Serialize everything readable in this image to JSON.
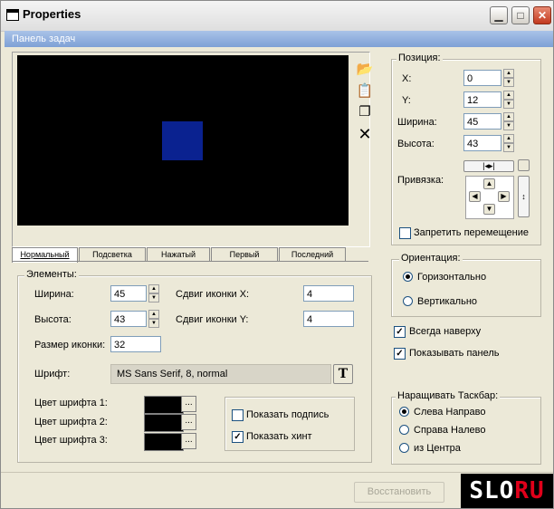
{
  "window": {
    "title": "Properties"
  },
  "panel_header": "Панель задач",
  "tabs": [
    "Нормальный",
    "Подсветка",
    "Нажатый",
    "Первый",
    "Последний"
  ],
  "elements": {
    "legend": "Элементы:",
    "width_label": "Ширина:",
    "width_value": "45",
    "height_label": "Высота:",
    "height_value": "43",
    "icon_size_label": "Размер иконки:",
    "icon_size_value": "32",
    "shift_x_label": "Сдвиг иконки X:",
    "shift_x_value": "4",
    "shift_y_label": "Сдвиг иконки Y:",
    "shift_y_value": "4",
    "font_label": "Шрифт:",
    "font_value": "MS Sans Serif, 8, normal",
    "font_button": "T",
    "color1_label": "Цвет шрифта 1:",
    "color2_label": "Цвет шрифта 2:",
    "color3_label": "Цвет шрифта 3:",
    "color_button": "...",
    "show_caption": "Показать подпись",
    "show_hint": "Показать хинт",
    "font_colors": [
      "#000000",
      "#000000",
      "#000000"
    ]
  },
  "position": {
    "legend": "Позиция:",
    "x_label": "X:",
    "x_value": "0",
    "y_label": "Y:",
    "y_value": "12",
    "width_label": "Ширина:",
    "width_value": "45",
    "height_label": "Высота:",
    "height_value": "43",
    "anchor_label": "Привязка:",
    "lock_move": "Запретить перемещение"
  },
  "orientation": {
    "legend": "Ориентация:",
    "horizontal": "Горизонтально",
    "vertical": "Вертикально"
  },
  "always_on_top": "Всегда наверху",
  "show_panel": "Показывать панель",
  "grow": {
    "legend": "Наращивать Таскбар:",
    "left_to_right": "Слева Направо",
    "right_to_left": "Справа Налево",
    "from_center": "из Центра"
  },
  "restore_button": "Восстановить",
  "logo": {
    "left": "SLO",
    "right": "RU"
  },
  "colors": {
    "preview_bg": "#000000",
    "preview_square": "#0a2290",
    "header_bar": "#8aaadc"
  }
}
